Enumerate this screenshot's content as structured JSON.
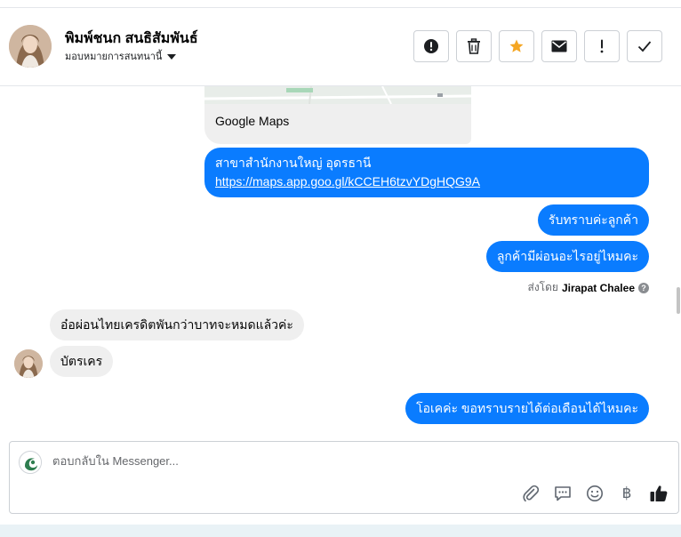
{
  "header": {
    "contact_name": "พิมพ์ชนก สนธิสัมพันธ์",
    "assign_label": "มอบหมายการสนทนานี้",
    "actions": [
      {
        "name": "spam-button",
        "icon": "exclamation-circle-icon"
      },
      {
        "name": "delete-button",
        "icon": "trash-icon"
      },
      {
        "name": "star-button",
        "icon": "star-icon",
        "color": "#f5a623"
      },
      {
        "name": "mark-unread-button",
        "icon": "envelope-icon"
      },
      {
        "name": "follow-up-button",
        "icon": "exclamation-icon"
      },
      {
        "name": "done-button",
        "icon": "check-icon"
      }
    ]
  },
  "messages": {
    "map_label": "Google Maps",
    "branch_line": "สาขาสำนักงานใหญ่ อุดรธานี",
    "branch_link": "https://maps.app.goo.gl/kCCEH6tzvYDgHQG9A",
    "ack": "รับทราบค่ะลูกค้า",
    "ask_installment": "ลูกค้ามีผ่อนอะไรอยู่ไหมคะ",
    "sent_by_prefix": "ส่งโดย",
    "sent_by_name": "Jirapat Chalee",
    "reply1": "อ๋อผ่อนไทยเครดิตพันกว่าบาทจะหมดแล้วค่ะ",
    "reply2": "บัตรเคร",
    "ask_income": "โอเคค่ะ ขอทราบรายได้ต่อเดือนได้ไหมคะ"
  },
  "composer": {
    "placeholder": "ตอบกลับใน Messenger...",
    "currency_symbol": "฿",
    "tools": [
      "paperclip-icon",
      "saved-reply-icon",
      "emoji-icon",
      "baht-icon",
      "thumbs-up-icon"
    ]
  },
  "colors": {
    "outgoing": "#0a7cff",
    "incoming": "#efefef",
    "accent_star": "#f5a623"
  }
}
